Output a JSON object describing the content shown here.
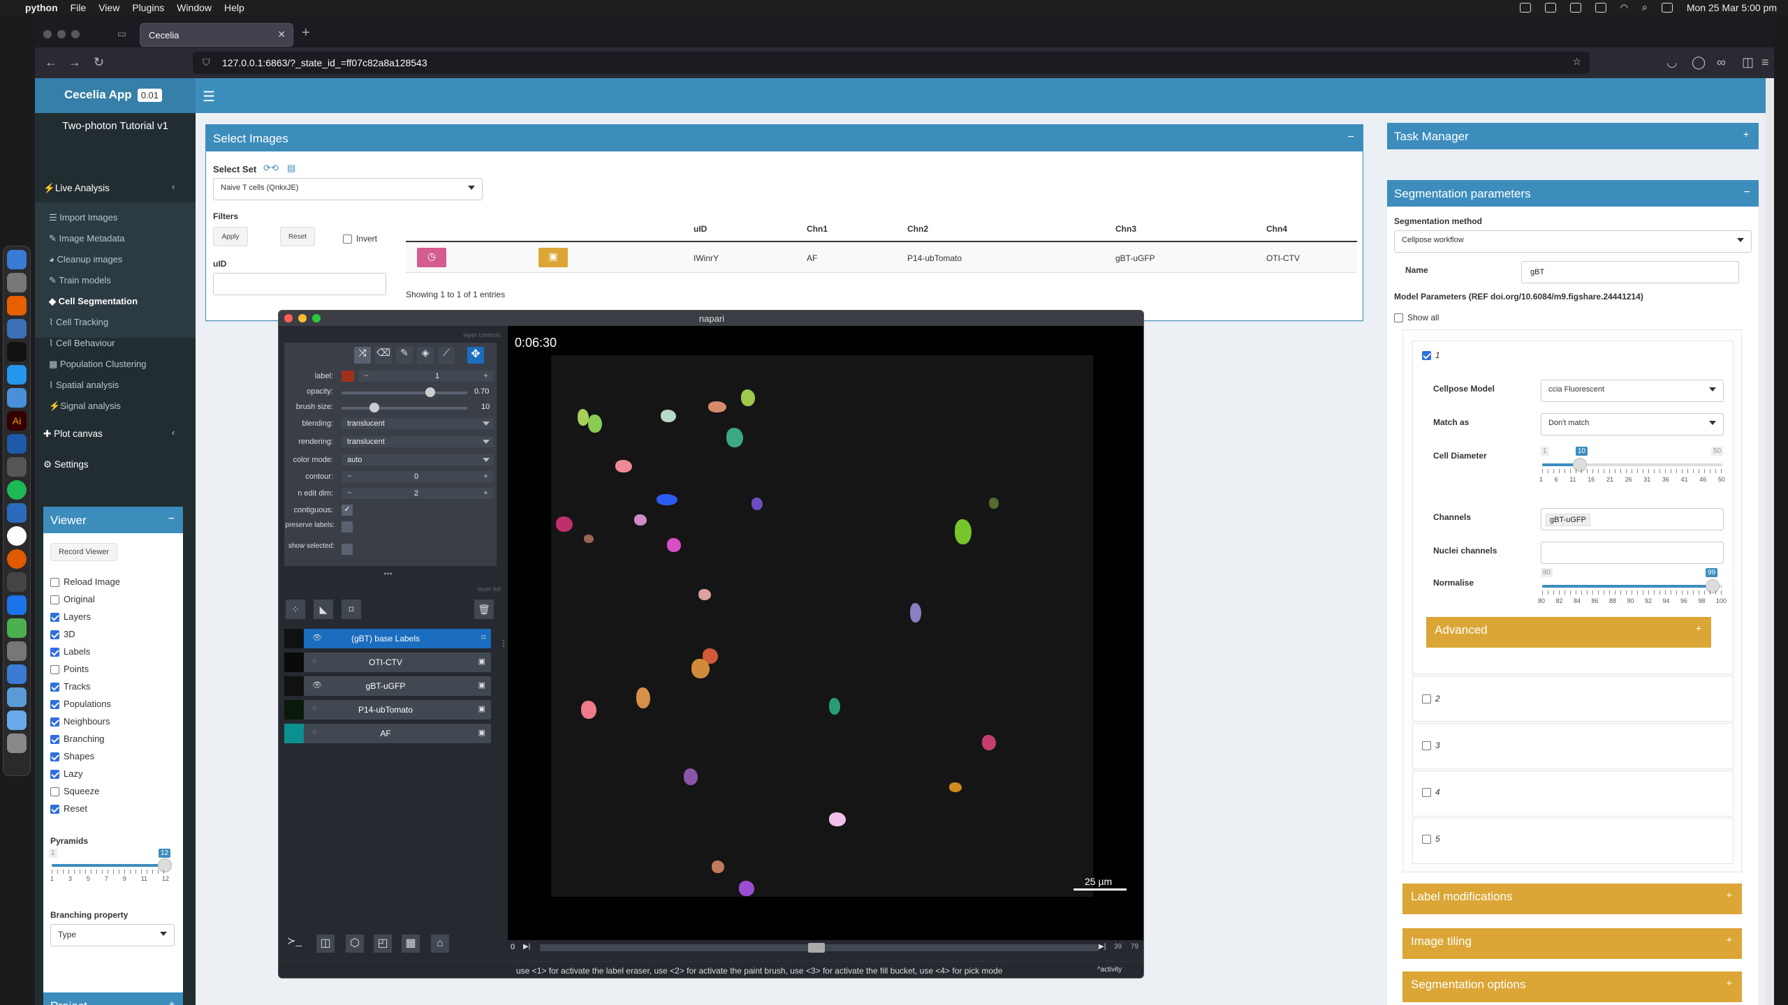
{
  "menubar": {
    "app": "python",
    "items": [
      "File",
      "View",
      "Plugins",
      "Window",
      "Help"
    ],
    "datetime": "Mon 25 Mar  5:00 pm"
  },
  "browser": {
    "tab_title": "Cecelia",
    "url": "127.0.0.1:6863/?_state_id_=ff07c82a8a128543"
  },
  "app": {
    "name": "Cecelia App",
    "version": "0.01",
    "project_title": "Two-photon Tutorial v1"
  },
  "sidebar": {
    "live_analysis": "Live Analysis",
    "items": [
      "Import Images",
      "Image Metadata",
      "Cleanup images",
      "Train models",
      "Cell Segmentation",
      "Cell Tracking",
      "Cell Behaviour",
      "Population Clustering",
      "Spatial analysis",
      "Signal analysis"
    ],
    "plot_canvas": "Plot canvas",
    "settings": "Settings"
  },
  "viewer": {
    "title": "Viewer",
    "record_button": "Record Viewer",
    "options": [
      {
        "label": "Reload Image",
        "checked": false
      },
      {
        "label": "Original",
        "checked": false
      },
      {
        "label": "Layers",
        "checked": true
      },
      {
        "label": "3D",
        "checked": true
      },
      {
        "label": "Labels",
        "checked": true
      },
      {
        "label": "Points",
        "checked": false
      },
      {
        "label": "Tracks",
        "checked": true
      },
      {
        "label": "Populations",
        "checked": true
      },
      {
        "label": "Neighbours",
        "checked": true
      },
      {
        "label": "Branching",
        "checked": true
      },
      {
        "label": "Shapes",
        "checked": true
      },
      {
        "label": "Lazy",
        "checked": true
      },
      {
        "label": "Squeeze",
        "checked": false
      },
      {
        "label": "Reset",
        "checked": true
      }
    ],
    "pyramids_label": "Pyramids",
    "pyramids_min": "1",
    "pyramids_value": "12",
    "pyramids_ticks": [
      "1",
      "3",
      "5",
      "7",
      "9",
      "11",
      "12"
    ],
    "branching_label": "Branching property",
    "branching_value": "Type"
  },
  "project": {
    "title": "Project"
  },
  "select_images": {
    "title": "Select Images",
    "select_set_label": "Select Set",
    "set_value": "Naive T cells (QnkxJE)",
    "filters_label": "Filters",
    "apply": "Apply",
    "reset": "Reset",
    "invert": "Invert",
    "uid_label": "uID",
    "columns": [
      "uID",
      "Chn1",
      "Chn2",
      "Chn3",
      "Chn4"
    ],
    "row": [
      "IWinrY",
      "AF",
      "P14-ubTomato",
      "gBT-uGFP",
      "OTI-CTV"
    ],
    "showing": "Showing 1 to 1 of 1 entries"
  },
  "task_manager": {
    "title": "Task Manager"
  },
  "segmentation": {
    "title": "Segmentation parameters",
    "method_label": "Segmentation method",
    "method_value": "Cellpose workflow",
    "name_label": "Name",
    "name_value": "gBT",
    "model_params": "Model Parameters (REF doi.org/10.6084/m9.figshare.24441214)",
    "show_all": "Show all",
    "model1_num": "1",
    "cellpose_model_label": "Cellpose Model",
    "cellpose_model_value": "ccia Fluorescent",
    "match_as_label": "Match as",
    "match_as_value": "Don't match",
    "cell_diameter_label": "Cell Diameter",
    "cd_min": "1",
    "cd_max": "50",
    "cd_value": "10",
    "cd_ticks": [
      "1",
      "6",
      "11",
      "16",
      "21",
      "26",
      "31",
      "36",
      "41",
      "46",
      "50"
    ],
    "channels_label": "Channels",
    "channels_value": "gBT-uGFP",
    "nuclei_label": "Nuclei channels",
    "normalise_label": "Normalise",
    "norm_low": "80",
    "norm_high": "99",
    "norm_ticks": [
      "80",
      "82",
      "84",
      "86",
      "88",
      "90",
      "92",
      "94",
      "96",
      "98",
      "100"
    ],
    "advanced": "Advanced",
    "models": [
      "2",
      "3",
      "4",
      "5"
    ],
    "label_modifications": "Label modifications",
    "image_tiling": "Image tiling",
    "segmentation_options": "Segmentation options"
  },
  "napari": {
    "title": "napari",
    "layer_controls": "layer controls",
    "layer_list": "layer list",
    "controls": {
      "label": "label:",
      "label_value": "1",
      "label_color": "#a0301c",
      "opacity": "opacity:",
      "opacity_value": "0.70",
      "brush_size": "brush size:",
      "brush_value": "10",
      "blending": "blending:",
      "blending_value": "translucent",
      "rendering": "rendering:",
      "rendering_value": "translucent",
      "color_mode": "color mode:",
      "color_mode_value": "auto",
      "contour": "contour:",
      "contour_value": "0",
      "n_edit_dim": "n edit dim:",
      "n_edit_value": "2",
      "contiguous": "contiguous:",
      "preserve": "preserve labels:",
      "show_selected": "show selected:"
    },
    "layers": [
      "(gBT) base Labels",
      "OTI-CTV",
      "gBT-uGFP",
      "P14-ubTomato",
      "AF"
    ],
    "time": "0:06:30",
    "scalebar": "25 µm",
    "slider_start": "0",
    "slider_val": "39",
    "slider_max": "79",
    "status": "use <1> for activate the label eraser, use <2> for activate the paint brush, use <3> for activate the fill bucket, use <4> for pick mode",
    "activity": "activity"
  }
}
